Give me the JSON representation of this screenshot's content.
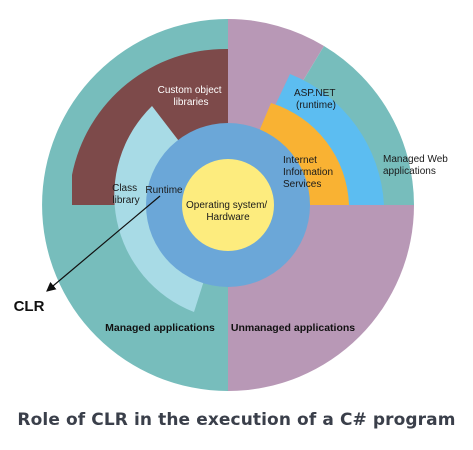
{
  "diagram": {
    "labels": {
      "custom_object_libraries": [
        "Custom object",
        "libraries"
      ],
      "class_library": [
        "Class",
        "library"
      ],
      "runtime": "Runtime",
      "os_hardware": [
        "Operating system/",
        "Hardware"
      ],
      "asp_net": [
        "ASP.NET",
        "(runtime)"
      ],
      "iis": [
        "Internet",
        "Information",
        "Services"
      ],
      "managed_web_apps": [
        "Managed Web",
        "applications"
      ],
      "clr": "CLR",
      "managed_apps": "Managed applications",
      "unmanaged_apps": "Unmanaged applications"
    },
    "colors": {
      "managed_teal": "#77bdbc",
      "unmanaged_mauve": "#b898b6",
      "custom_libs_brown": "#7d4a4a",
      "class_library_lightblue": "#a8dbe6",
      "runtime_blue": "#6ba7d8",
      "os_yellow": "#fdec7e",
      "asp_net_blue": "#5cbdf1",
      "iis_orange": "#f9b233"
    }
  },
  "caption": "Role of CLR in the execution of a C# program"
}
